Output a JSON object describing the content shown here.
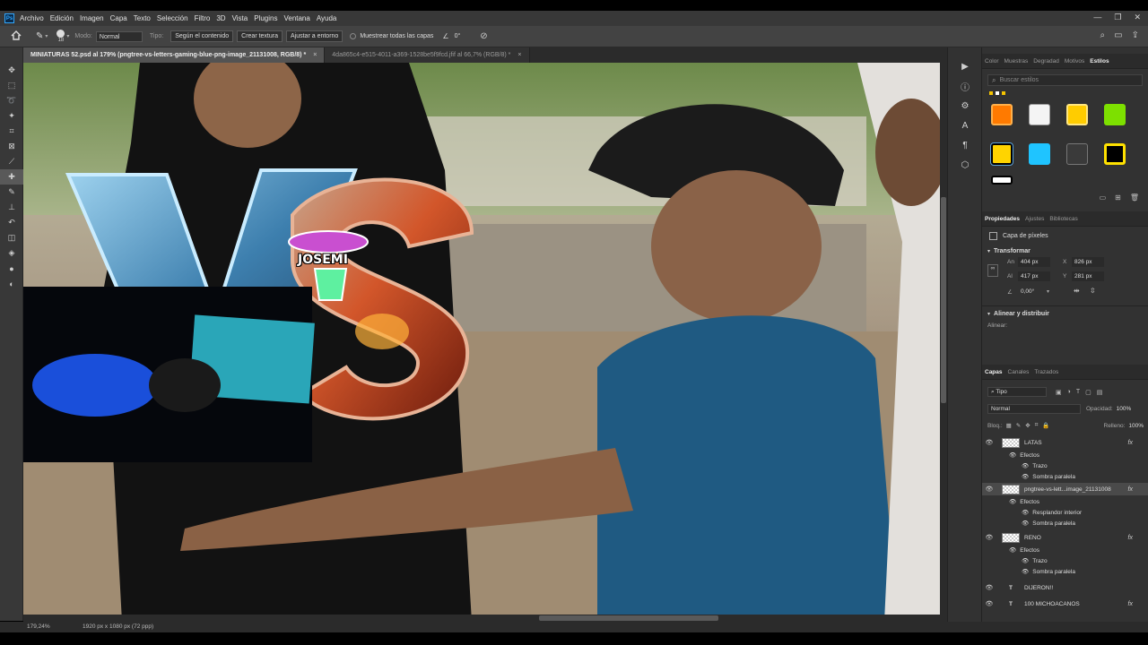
{
  "app": {
    "logo": "Ps"
  },
  "menu": [
    "Archivo",
    "Edición",
    "Imagen",
    "Capa",
    "Texto",
    "Selección",
    "Filtro",
    "3D",
    "Vista",
    "Plugins",
    "Ventana",
    "Ayuda"
  ],
  "window_controls": [
    "—",
    "❐",
    "✕"
  ],
  "options": {
    "brush_size": "18",
    "mode_label": "Modo:",
    "mode_value": "Normal",
    "type_label": "Tipo:",
    "btn_content": "Según el contenido",
    "btn_texture": "Crear textura",
    "btn_adjust": "Ajustar a entorno",
    "sample_all": "Muestrear todas las capas",
    "angle": "0°"
  },
  "tabs": [
    {
      "label": "MINIATURAS 52.psd al 179% (pngtree-vs-letters-gaming-blue-png-image_21131008, RGB/8) *",
      "active": true
    },
    {
      "label": "4da865c4-e515-4011-a369-1528be5f9fcd.jfif al 66,7% (RGB/8) *",
      "active": false
    }
  ],
  "canvas": {
    "logo_text": "JOSEMI",
    "vs_text": "VS"
  },
  "color_panel": {
    "tabs": [
      "Color",
      "Muestras",
      "Degradad",
      "Motivos",
      "Estilos"
    ],
    "active_tab": "Estilos",
    "search_placeholder": "Buscar estilos"
  },
  "properties": {
    "tabs": [
      "Propiedades",
      "Ajustes",
      "Bibliotecas"
    ],
    "active_tab": "Propiedades",
    "layer_type": "Capa de píxeles",
    "transform_title": "Transformar",
    "w_label": "An",
    "w_value": "404 px",
    "x_label": "X",
    "x_value": "826 px",
    "h_label": "Al",
    "h_value": "417 px",
    "y_label": "Y",
    "y_value": "281 px",
    "angle_value": "0,00°",
    "align_title": "Alinear y distribuir",
    "align_label": "Alinear:"
  },
  "layers_panel": {
    "tabs": [
      "Capas",
      "Canales",
      "Trazados"
    ],
    "active_tab": "Capas",
    "filter_value": "Tipo",
    "blend_mode": "Normal",
    "opacity_label": "Opacidad:",
    "opacity_value": "100%",
    "lock_label": "Bloq.:",
    "fill_label": "Relleno:",
    "fill_value": "100%",
    "layers": [
      {
        "name": "LATAS",
        "kind": "pixel",
        "fx": "fx"
      },
      {
        "name": "Efectos",
        "kind": "effects"
      },
      {
        "name": "Trazo",
        "kind": "effect"
      },
      {
        "name": "Sombra paralela",
        "kind": "effect"
      },
      {
        "name": "pngtree-vs-lett...image_21131008",
        "kind": "pixel",
        "fx": "fx",
        "selected": true
      },
      {
        "name": "Efectos",
        "kind": "effects"
      },
      {
        "name": "Resplandor interior",
        "kind": "effect"
      },
      {
        "name": "Sombra paralela",
        "kind": "effect"
      },
      {
        "name": "RENO",
        "kind": "pixel",
        "fx": "fx"
      },
      {
        "name": "Efectos",
        "kind": "effects"
      },
      {
        "name": "Trazo",
        "kind": "effect"
      },
      {
        "name": "Sombra paralela",
        "kind": "effect"
      },
      {
        "name": "DIJERON!!",
        "kind": "text"
      },
      {
        "name": "100 MICHOACANOS",
        "kind": "text",
        "fx": "fx"
      }
    ]
  },
  "status": {
    "zoom": "179,24%",
    "doc_info": "1920 px x 1080 px (72 ppp)"
  }
}
